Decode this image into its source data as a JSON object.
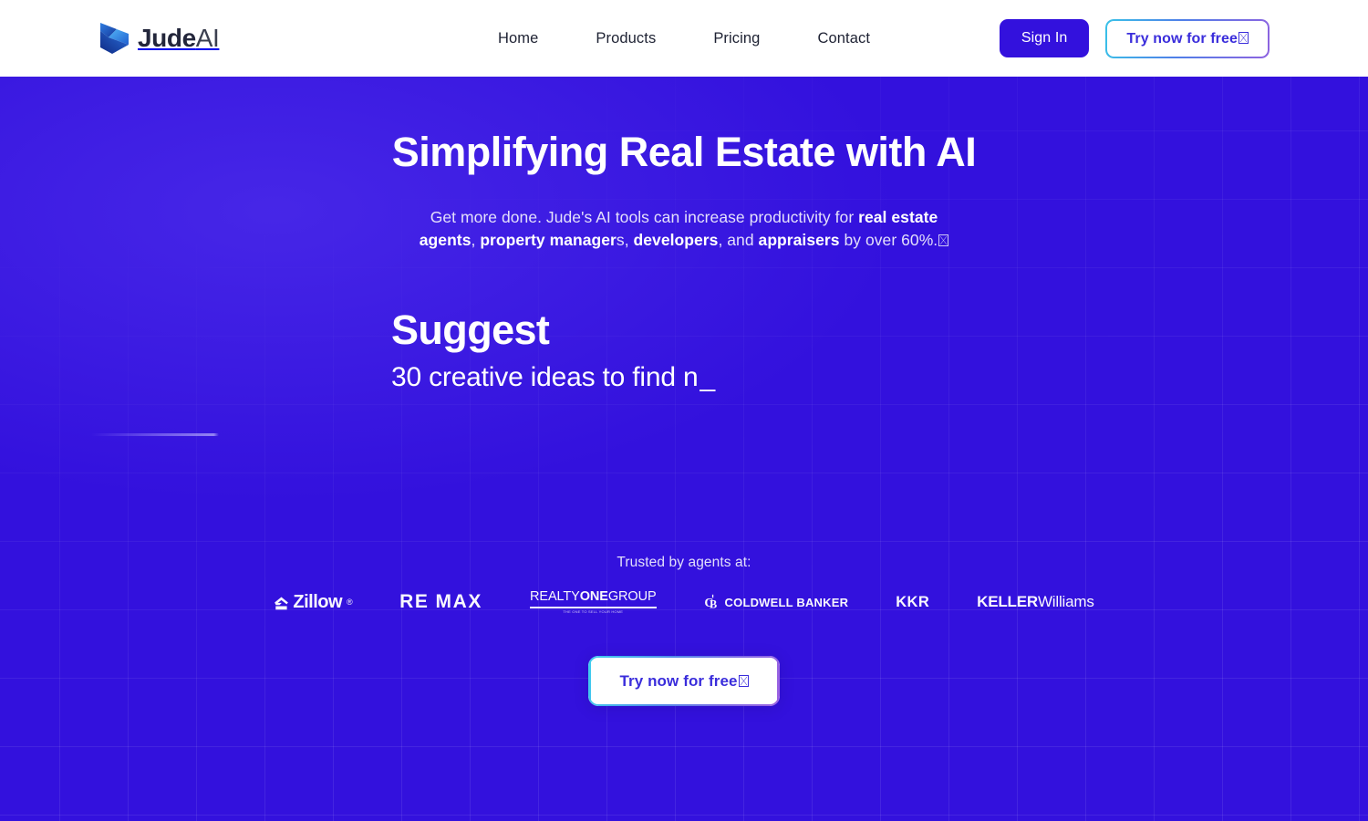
{
  "brand": {
    "name_bold": "Jude",
    "name_light": "AI",
    "logo_icon": "judeai-arrow-logo"
  },
  "nav": {
    "items": [
      {
        "label": "Home"
      },
      {
        "label": "Products"
      },
      {
        "label": "Pricing"
      },
      {
        "label": "Contact"
      }
    ]
  },
  "header_actions": {
    "sign_in_label": "Sign In",
    "try_free_label": "Try now for free"
  },
  "hero": {
    "title": "Simplifying Real Estate with AI",
    "subtitle": {
      "part1": "Get more done. Jude's AI tools can increase productivity for ",
      "bold1": "real estate agents",
      "part2": ", ",
      "bold2": "property manager",
      "part3": "s, ",
      "bold3": "developers",
      "part4": ", and ",
      "bold4": "appraisers",
      "part5": " by over 60%."
    },
    "typewriter": {
      "heading": "Suggest",
      "line": "30 creative ideas to find n",
      "caret": "_"
    },
    "cta_label": "Try now for free"
  },
  "trusted": {
    "label": "Trusted by agents at:",
    "logos": [
      {
        "id": "zillow",
        "name": "Zillow",
        "tm": "®"
      },
      {
        "id": "remax",
        "part_a": "RE",
        "part_b": "MAX"
      },
      {
        "id": "realty-one-group",
        "thin_a": "REALTY",
        "thick": "ONE",
        "thin_b": "GROUP",
        "tagline": "THE ONE TO SELL YOUR HOME"
      },
      {
        "id": "coldwell-banker",
        "name": "COLDWELL BANKER"
      },
      {
        "id": "kkr",
        "name": "KKR"
      },
      {
        "id": "keller-williams",
        "bold": "KELLER",
        "light": "Williams"
      }
    ]
  },
  "colors": {
    "background": "#3311dd",
    "header_bg": "#ffffff",
    "accent_button": "#3311dd",
    "cta_text": "#3a2ddb",
    "gradient_start": "#3fd0ef",
    "gradient_end": "#9d62e2"
  }
}
